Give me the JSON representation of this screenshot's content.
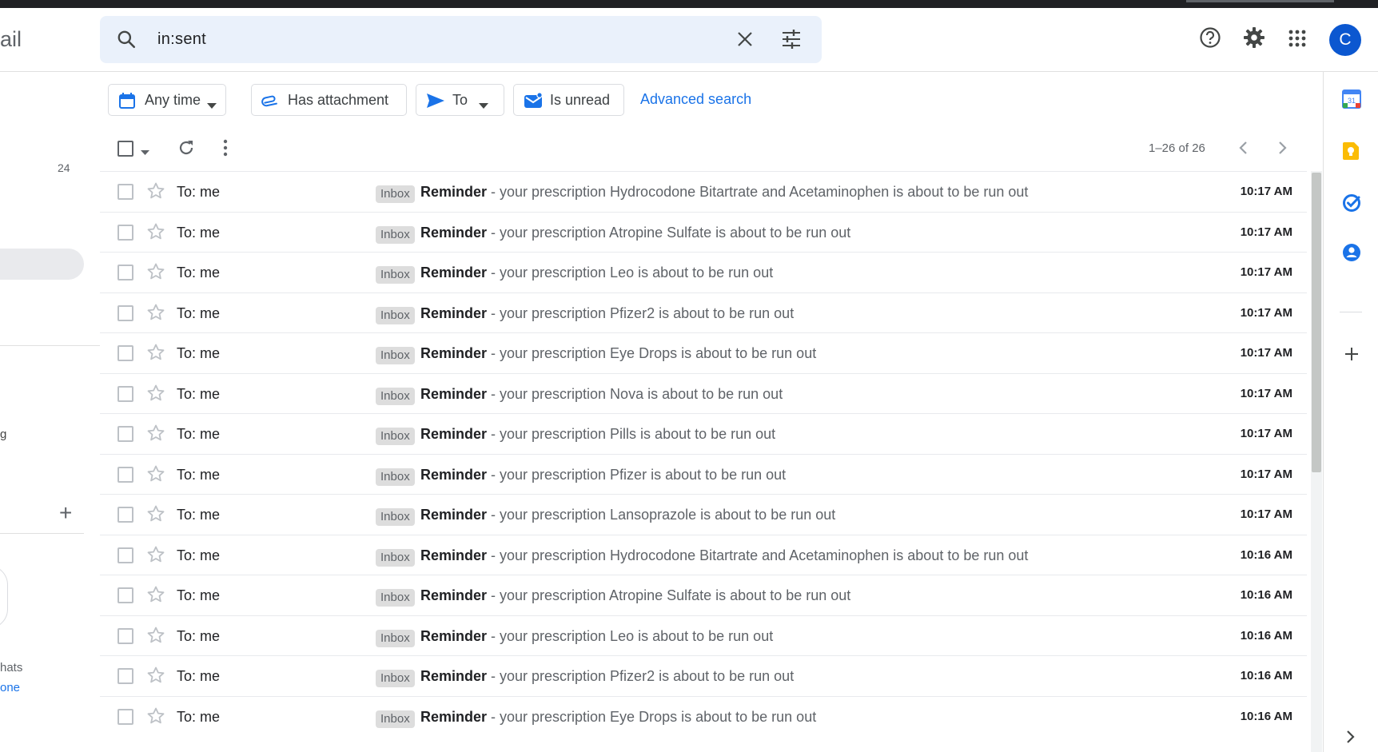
{
  "app": {
    "brand_fragment": "ail"
  },
  "search": {
    "query": "in:sent"
  },
  "header": {
    "help_icon": "help-circle-icon",
    "settings_icon": "gear-icon",
    "apps_icon": "grid-icon",
    "avatar_letter": "C"
  },
  "chips": {
    "any_time": "Any time",
    "has_attachment": "Has attachment",
    "to": "To",
    "is_unread": "Is unread",
    "advanced": "Advanced search"
  },
  "left_nav": {
    "count": "24",
    "partial_g": "g",
    "chats_fragment": "hats",
    "one_fragment": "one"
  },
  "toolbar": {
    "pager": "1–26 of 26"
  },
  "emails": [
    {
      "sender": "To: me",
      "label": "Inbox",
      "subject": "Reminder",
      "snippet": " - your prescription Hydrocodone Bitartrate and Acetaminophen is about to be run out",
      "time": "10:17 AM"
    },
    {
      "sender": "To: me",
      "label": "Inbox",
      "subject": "Reminder",
      "snippet": " - your prescription Atropine Sulfate is about to be run out",
      "time": "10:17 AM"
    },
    {
      "sender": "To: me",
      "label": "Inbox",
      "subject": "Reminder",
      "snippet": " - your prescription Leo is about to be run out",
      "time": "10:17 AM"
    },
    {
      "sender": "To: me",
      "label": "Inbox",
      "subject": "Reminder",
      "snippet": " - your prescription Pfizer2 is about to be run out",
      "time": "10:17 AM"
    },
    {
      "sender": "To: me",
      "label": "Inbox",
      "subject": "Reminder",
      "snippet": " - your prescription Eye Drops is about to be run out",
      "time": "10:17 AM"
    },
    {
      "sender": "To: me",
      "label": "Inbox",
      "subject": "Reminder",
      "snippet": " - your prescription Nova is about to be run out",
      "time": "10:17 AM"
    },
    {
      "sender": "To: me",
      "label": "Inbox",
      "subject": "Reminder",
      "snippet": " - your prescription Pills is about to be run out",
      "time": "10:17 AM"
    },
    {
      "sender": "To: me",
      "label": "Inbox",
      "subject": "Reminder",
      "snippet": " - your prescription Pfizer is about to be run out",
      "time": "10:17 AM"
    },
    {
      "sender": "To: me",
      "label": "Inbox",
      "subject": "Reminder",
      "snippet": " - your prescription Lansoprazole is about to be run out",
      "time": "10:17 AM"
    },
    {
      "sender": "To: me",
      "label": "Inbox",
      "subject": "Reminder",
      "snippet": " - your prescription Hydrocodone Bitartrate and Acetaminophen is about to be run out",
      "time": "10:16 AM"
    },
    {
      "sender": "To: me",
      "label": "Inbox",
      "subject": "Reminder",
      "snippet": " - your prescription Atropine Sulfate is about to be run out",
      "time": "10:16 AM"
    },
    {
      "sender": "To: me",
      "label": "Inbox",
      "subject": "Reminder",
      "snippet": " - your prescription Leo is about to be run out",
      "time": "10:16 AM"
    },
    {
      "sender": "To: me",
      "label": "Inbox",
      "subject": "Reminder",
      "snippet": " - your prescription Pfizer2 is about to be run out",
      "time": "10:16 AM"
    },
    {
      "sender": "To: me",
      "label": "Inbox",
      "subject": "Reminder",
      "snippet": " - your prescription Eye Drops is about to be run out",
      "time": "10:16 AM"
    }
  ],
  "side_panel": {
    "icons": [
      "calendar-icon",
      "keep-icon",
      "tasks-icon",
      "contacts-icon",
      "add-icon",
      "chevron-right-icon"
    ],
    "calendar_day": "31"
  },
  "colors": {
    "accent": "#1a73e8",
    "avatar": "#0b57d0",
    "search_bg": "#eaf1fb",
    "label_bg": "#dddddd"
  }
}
